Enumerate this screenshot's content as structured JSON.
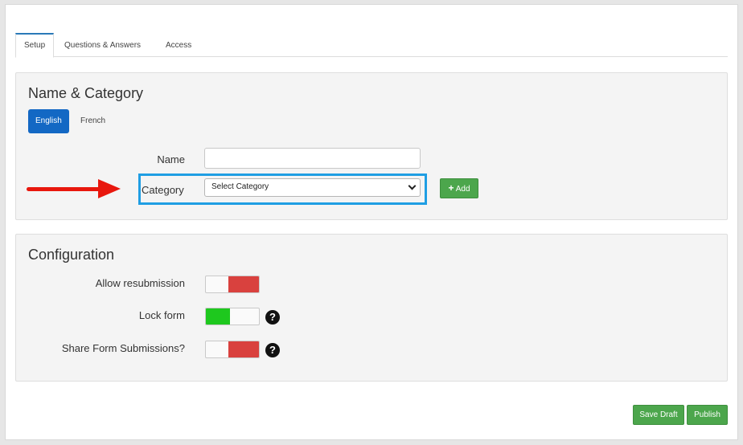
{
  "tabs": [
    "Setup",
    "Questions & Answers",
    "Access"
  ],
  "name_category": {
    "title": "Name & Category",
    "languages": [
      "English",
      "French"
    ],
    "name_label": "Name",
    "name_value": "",
    "category_label": "Category",
    "category_selected": "Select Category",
    "add_label": "Add",
    "add_icon": "plus-icon"
  },
  "configuration": {
    "title": "Configuration",
    "toggles": [
      {
        "label": "Allow resubmission",
        "state": "off",
        "help": false
      },
      {
        "label": "Lock form",
        "state": "on",
        "help": true
      },
      {
        "label": "Share Form Submissions?",
        "state": "off",
        "help": true
      }
    ],
    "help_glyph": "?"
  },
  "footer": {
    "save_draft": "Save Draft",
    "publish": "Publish"
  },
  "colors": {
    "primary": "#1368c4",
    "success": "#4ca64c",
    "toggle_on": "#1ec81e",
    "toggle_off": "#d9413e",
    "highlight": "#1f9ee3",
    "annotation_arrow": "#e8170d"
  }
}
